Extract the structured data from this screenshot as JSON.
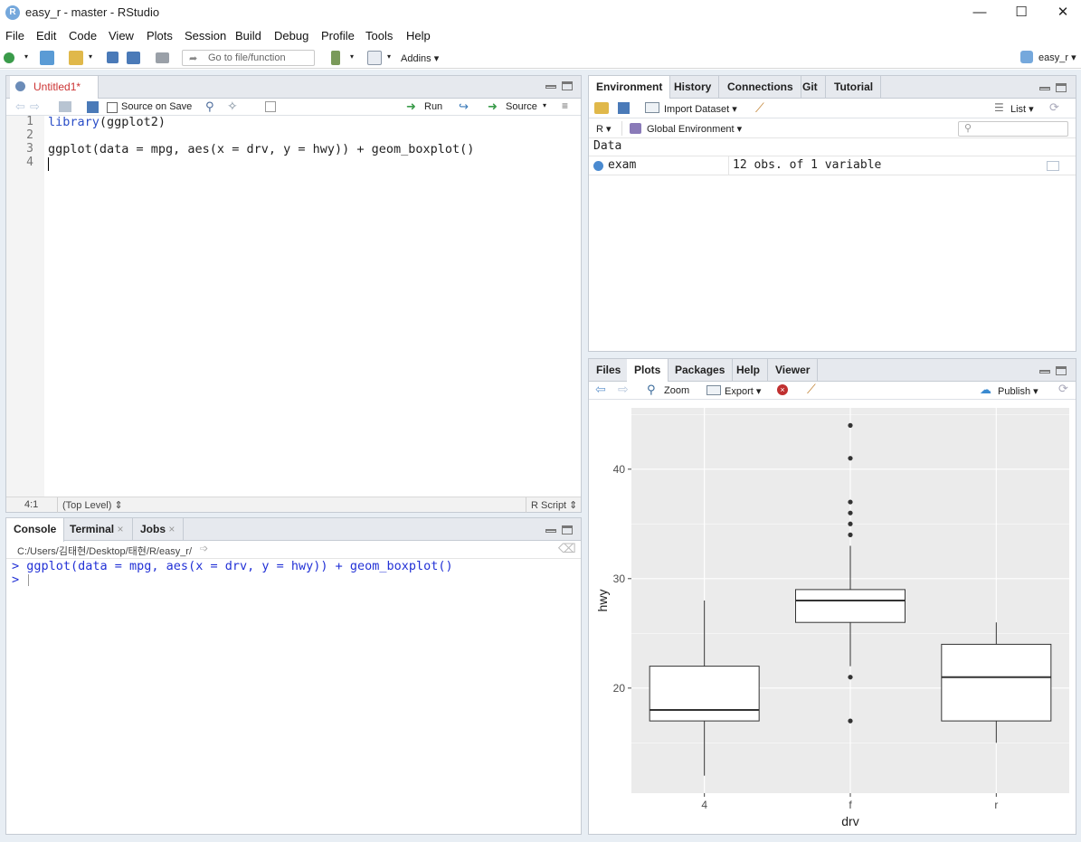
{
  "window": {
    "title": "easy_r - master - RStudio",
    "app_icon_letter": "R",
    "minimize": "—",
    "maximize": "☐",
    "close": "✕"
  },
  "menu": [
    "File",
    "Edit",
    "Code",
    "View",
    "Plots",
    "Session",
    "Build",
    "Debug",
    "Profile",
    "Tools",
    "Help"
  ],
  "main_toolbar": {
    "goto_placeholder": "Go to file/function",
    "addins_label": "Addins",
    "project_label": "easy_r"
  },
  "editor": {
    "tab_label": "Untitled1*",
    "source_on_save_label": "Source on Save",
    "run_label": "Run",
    "source_label": "Source",
    "line_numbers": [
      "1",
      "2",
      "3",
      "4"
    ],
    "code_lines": [
      {
        "pre": "",
        "kw": "library",
        "post": "(ggplot2)"
      },
      {
        "pre": "",
        "kw": "",
        "post": ""
      },
      {
        "pre": "",
        "kw": "",
        "post": "ggplot(data = mpg, aes(x = drv, y = hwy)) + geom_boxplot()"
      },
      {
        "pre": "",
        "kw": "",
        "post": ""
      }
    ],
    "status_position": "4:1",
    "status_scope": "(Top Level)",
    "status_filetype": "R Script"
  },
  "console": {
    "tabs": [
      "Console",
      "Terminal",
      "Jobs"
    ],
    "path": "C:/Users/김태현/Desktop/태현/R/easy_r/",
    "lines": [
      "> ggplot(data = mpg, aes(x = drv, y = hwy)) + geom_boxplot()",
      "> "
    ]
  },
  "environment": {
    "tabs": [
      "Environment",
      "History",
      "Connections",
      "Git",
      "Tutorial"
    ],
    "import_dataset_label": "Import Dataset",
    "list_label": "List",
    "r_label": "R",
    "global_env_label": "Global Environment",
    "section_header": "Data",
    "rows": [
      {
        "name": "exam",
        "value": "12 obs. of 1 variable"
      }
    ]
  },
  "files_pane": {
    "tabs": [
      "Files",
      "Plots",
      "Packages",
      "Help",
      "Viewer"
    ],
    "zoom_label": "Zoom",
    "export_label": "Export",
    "publish_label": "Publish"
  },
  "colors": {
    "panel_bg": "#ebebeb",
    "grid": "#ffffff",
    "box_fill": "#ffffff",
    "box_stroke": "#333333",
    "code_keyword": "#2b4ec7",
    "console_text": "#2231d6",
    "tab_modified": "#cc3333"
  },
  "chart_data": {
    "type": "boxplot",
    "xlabel": "drv",
    "ylabel": "hwy",
    "categories": [
      "4",
      "f",
      "r"
    ],
    "y_ticks": [
      20,
      30,
      40
    ],
    "ylim": [
      10.4,
      45.6
    ],
    "grid": true,
    "boxes": [
      {
        "category": "4",
        "whisker_low": 12,
        "q1": 17,
        "median": 18,
        "q3": 22,
        "whisker_high": 28,
        "outliers": []
      },
      {
        "category": "f",
        "whisker_low": 22,
        "q1": 26,
        "median": 28,
        "q3": 29,
        "whisker_high": 33,
        "outliers": [
          21,
          17,
          34,
          35,
          36,
          37,
          41,
          44
        ]
      },
      {
        "category": "r",
        "whisker_low": 15,
        "q1": 17,
        "median": 21,
        "q3": 24,
        "whisker_high": 26,
        "outliers": []
      }
    ]
  }
}
